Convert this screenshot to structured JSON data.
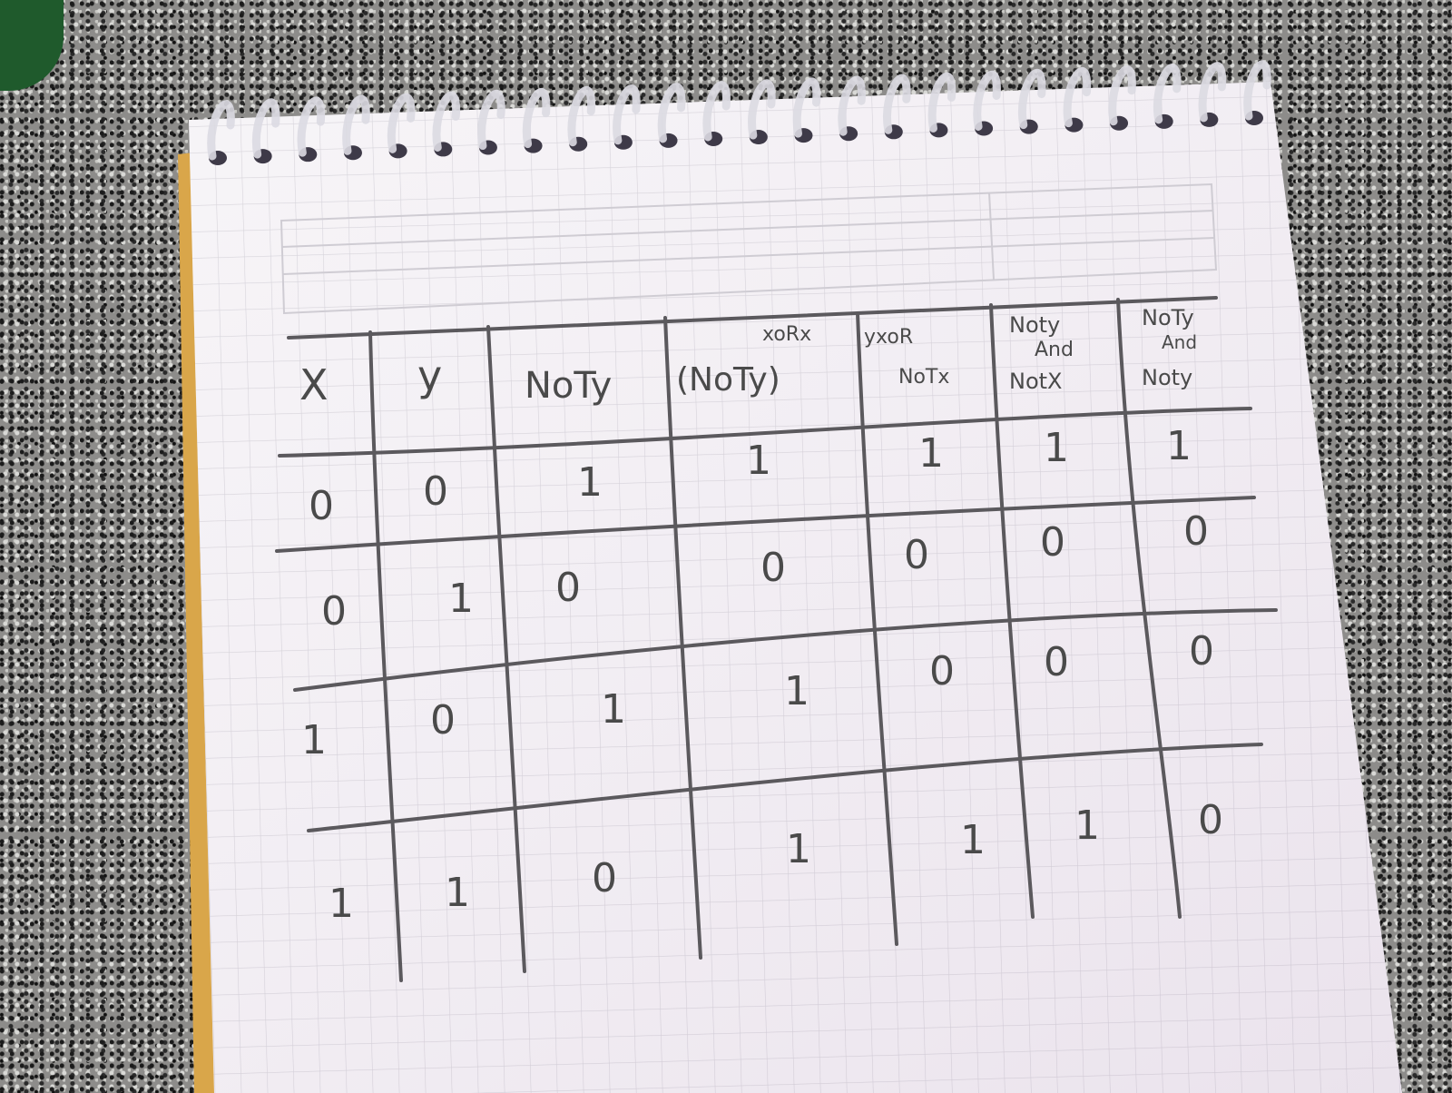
{
  "colors": {
    "paper": "#f4f1f5",
    "grid_line": "#c9c6cc",
    "pencil": "#555356",
    "spiral": "#d9d7df",
    "spine_edge": "#d9a64a"
  },
  "truth_table": {
    "headers": [
      {
        "lines": [
          "X"
        ]
      },
      {
        "lines": [
          "y"
        ]
      },
      {
        "lines": [
          "NoTy"
        ]
      },
      {
        "lines": [
          "xoRx",
          "(NoTy)"
        ]
      },
      {
        "lines": [
          "yxoR",
          "NoTx"
        ]
      },
      {
        "lines": [
          "Noty",
          "And",
          "NotX"
        ]
      },
      {
        "lines": [
          "NoTy",
          "And",
          "Noty"
        ]
      }
    ],
    "rows": [
      [
        "0",
        "0",
        "1",
        "1",
        "1",
        "1",
        "1"
      ],
      [
        "0",
        "1",
        "0",
        "0",
        "0",
        "0",
        "0"
      ],
      [
        "1",
        "0",
        "1",
        "1",
        "0",
        "0",
        "0"
      ],
      [
        "1",
        "1",
        "0",
        "1",
        "1",
        "1",
        "0"
      ]
    ]
  }
}
